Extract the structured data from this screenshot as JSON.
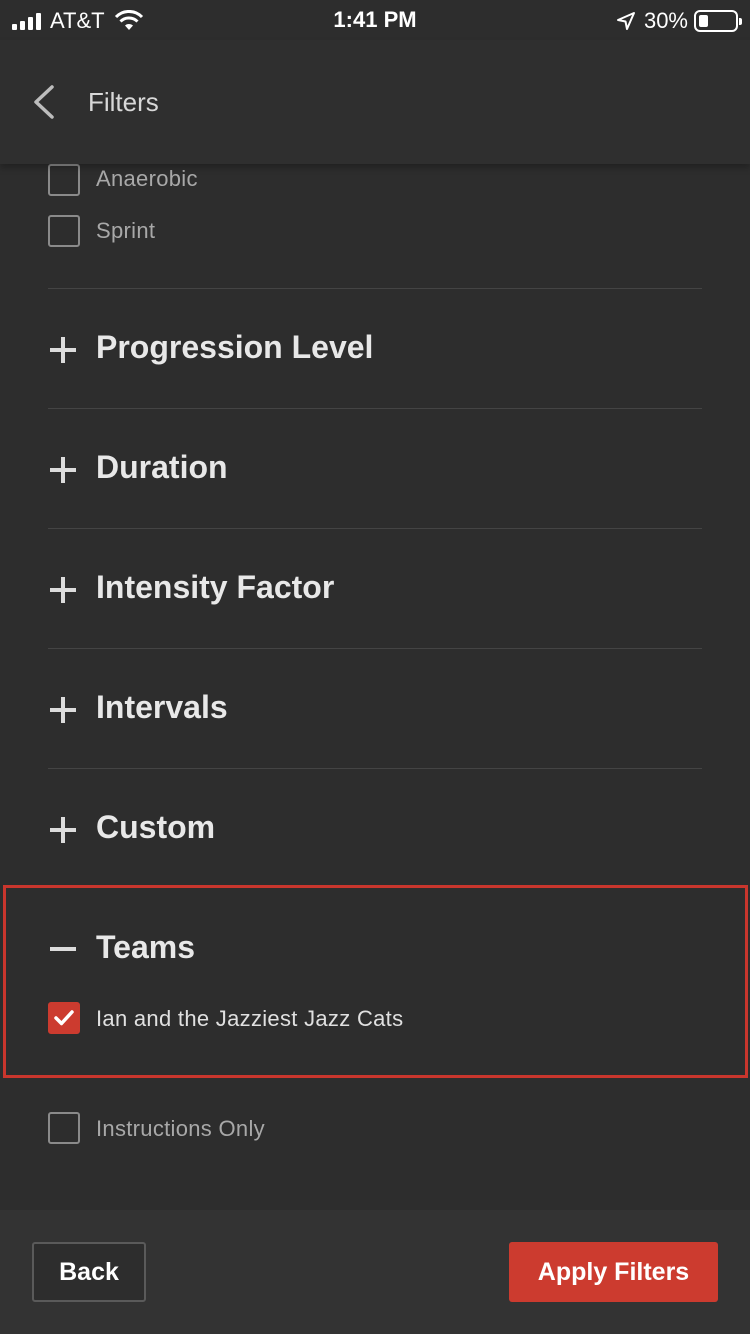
{
  "status_bar": {
    "carrier": "AT&T",
    "time": "1:41 PM",
    "battery_percent": "30%",
    "icons": [
      "signal-icon",
      "wifi-icon",
      "location-arrow-icon",
      "battery-icon"
    ]
  },
  "header": {
    "title": "Filters",
    "back_icon": "chevron-left-icon"
  },
  "workout_types": [
    {
      "label": "Anaerobic",
      "checked": false
    },
    {
      "label": "Sprint",
      "checked": false
    }
  ],
  "sections": [
    {
      "title": "Progression Level",
      "expanded": false
    },
    {
      "title": "Duration",
      "expanded": false
    },
    {
      "title": "Intensity Factor",
      "expanded": false
    },
    {
      "title": "Intervals",
      "expanded": false
    },
    {
      "title": "Custom",
      "expanded": false
    }
  ],
  "teams": {
    "title": "Teams",
    "expanded": true,
    "items": [
      {
        "label": "Ian and the Jazziest Jazz Cats",
        "checked": true
      }
    ]
  },
  "instructions_only": {
    "label": "Instructions Only",
    "checked": false
  },
  "footer": {
    "back_label": "Back",
    "apply_label": "Apply Filters"
  },
  "colors": {
    "background": "#2d2d2d",
    "accent": "#cc3b2f",
    "highlight_border": "#c9362d"
  }
}
